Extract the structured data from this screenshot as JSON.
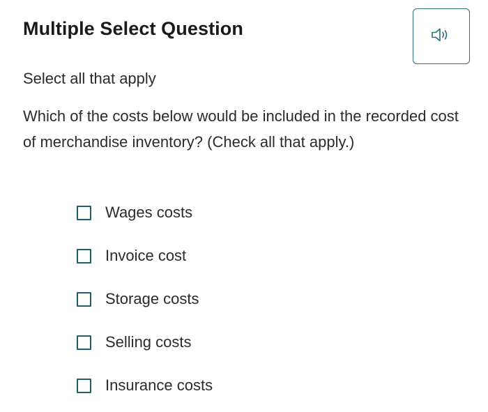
{
  "header": {
    "title": "Multiple Select Question",
    "audio_icon": "speaker-icon",
    "accent_color": "#2a6f7c"
  },
  "question": {
    "instruction": "Select all that apply",
    "prompt": "Which of the costs below would be included in the recorded cost of merchandise inventory? (Check all that apply.)"
  },
  "options": [
    {
      "label": "Wages costs",
      "checked": false
    },
    {
      "label": "Invoice cost",
      "checked": false
    },
    {
      "label": "Storage costs",
      "checked": false
    },
    {
      "label": "Selling costs",
      "checked": false
    },
    {
      "label": "Insurance costs",
      "checked": false
    }
  ]
}
